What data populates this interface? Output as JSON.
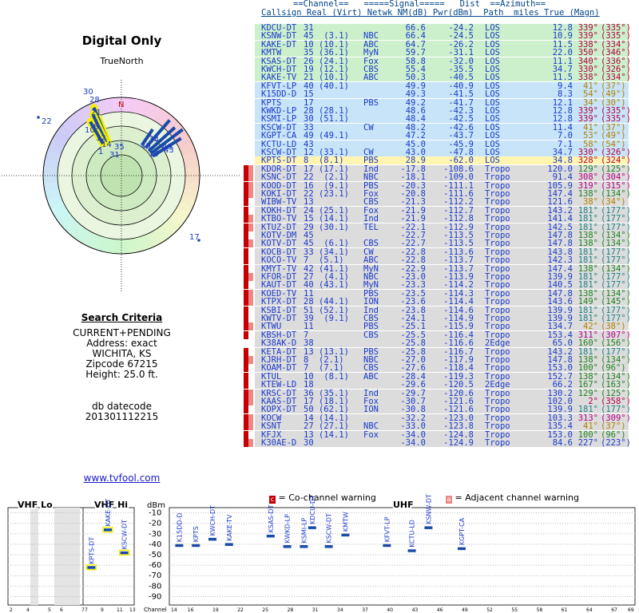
{
  "left": {
    "title": "Digital Only",
    "true_north_label": "TrueNorth",
    "north_marker": "N",
    "search_header": "Search Criteria",
    "search_lines": [
      "CURRENT+PENDING",
      "Address: exact",
      "WICHITA, KS",
      "Zipcode 67215",
      "Height: 25.0 ft."
    ],
    "db_header": "db datecode",
    "db_value": "201301112215",
    "site": "www.tvfool.com",
    "polar_labels": [
      {
        "t": "30",
        "c": "#1a3acc"
      },
      {
        "t": "28",
        "c": "#1a3acc"
      },
      {
        "t": "22",
        "c": "#1a3acc"
      },
      {
        "t": "21",
        "c": "#1a3acc"
      },
      {
        "t": "10",
        "c": "#1a3acc"
      },
      {
        "t": "12",
        "c": "#1a3acc"
      },
      {
        "t": "35",
        "c": "#1a3acc"
      },
      {
        "t": "31",
        "c": "#1a3acc"
      },
      {
        "t": "14",
        "c": "#1a3acc"
      },
      {
        "t": "33",
        "c": "#1a3acc"
      },
      {
        "t": "40",
        "c": "#1a3acc"
      },
      {
        "t": "49",
        "c": "#1a3acc"
      },
      {
        "t": "15",
        "c": "#1a3acc"
      },
      {
        "t": "43",
        "c": "#1a3acc"
      },
      {
        "t": "17",
        "c": "#1a3acc"
      },
      {
        "t": "8",
        "c": "#1a3acc"
      },
      {
        "t": "1",
        "c": "#1a3acc"
      }
    ]
  },
  "table": {
    "header_line1": "==Channel==   =====Signal=====   Dist  ==Azimuth==",
    "header_line2": "Callsign Real (Virt) Netwk NM(dB) Pwr(dBm)  Path  miles True (Magn)",
    "rows": [
      {
        "cs": "KDCU-DT",
        "rv": "31",
        "nw": "",
        "nm": "66.6",
        "pw": "-24.2",
        "pt": "LOS",
        "di": "12.8",
        "az": "339°",
        "mg": "(335°)",
        "bg": "green",
        "w": "",
        "ac": "#b00040"
      },
      {
        "cs": "KSNW-DT",
        "rv": "45  (3.1)",
        "nw": "NBC",
        "nm": "66.4",
        "pw": "-24.5",
        "pt": "LOS",
        "di": "10.9",
        "az": "339°",
        "mg": "(335°)",
        "bg": "green",
        "w": "",
        "ac": "#b00040"
      },
      {
        "cs": "KAKE-DT",
        "rv": "10 (10.1)",
        "nw": "ABC",
        "nm": "64.7",
        "pw": "-26.2",
        "pt": "LOS",
        "di": "11.5",
        "az": "338°",
        "mg": "(334°)",
        "bg": "green",
        "w": "",
        "ac": "#b00040"
      },
      {
        "cs": "KMTW",
        "rv": "35 (36.1)",
        "nw": "MyN",
        "nm": "59.7",
        "pw": "-31.1",
        "pt": "LOS",
        "di": "22.0",
        "az": "350°",
        "mg": "(346°)",
        "bg": "green",
        "w": "",
        "ac": "#b00040"
      },
      {
        "cs": "KSAS-DT",
        "rv": "26 (24.1)",
        "nw": "Fox",
        "nm": "58.8",
        "pw": "-32.0",
        "pt": "LOS",
        "di": "11.1",
        "az": "340°",
        "mg": "(336°)",
        "bg": "green",
        "w": "",
        "ac": "#b00040"
      },
      {
        "cs": "KWCH-DT",
        "rv": "19 (12.1)",
        "nw": "CBS",
        "nm": "55.4",
        "pw": "-35.5",
        "pt": "LOS",
        "di": "34.7",
        "az": "330°",
        "mg": "(326°)",
        "bg": "green",
        "w": "",
        "ac": "#b00040"
      },
      {
        "cs": "KAKE-TV",
        "rv": "21 (10.1)",
        "nw": "ABC",
        "nm": "50.3",
        "pw": "-40.5",
        "pt": "LOS",
        "di": "11.5",
        "az": "338°",
        "mg": "(334°)",
        "bg": "green",
        "w": "",
        "ac": "#b00040"
      },
      {
        "cs": "KFVT-LP",
        "rv": "40 (40.1)",
        "nw": "",
        "nm": "49.9",
        "pw": "-40.9",
        "pt": "LOS",
        "di": "9.4",
        "az": "41°",
        "mg": "(37°)",
        "bg": "blue",
        "w": "",
        "ac": "#b08000"
      },
      {
        "cs": "K15DD-D",
        "rv": "15",
        "nw": "",
        "nm": "49.3",
        "pw": "-41.5",
        "pt": "LOS",
        "di": "8.3",
        "az": "54°",
        "mg": "(49°)",
        "bg": "blue",
        "w": "",
        "ac": "#b08000"
      },
      {
        "cs": "KPTS",
        "rv": "17",
        "nw": "PBS",
        "nm": "49.2",
        "pw": "-41.7",
        "pt": "LOS",
        "di": "12.1",
        "az": "34°",
        "mg": "(30°)",
        "bg": "blue",
        "w": "",
        "ac": "#b08000"
      },
      {
        "cs": "KWKD-LP",
        "rv": "28 (28.1)",
        "nw": "",
        "nm": "48.6",
        "pw": "-42.3",
        "pt": "LOS",
        "di": "12.8",
        "az": "339°",
        "mg": "(335°)",
        "bg": "blue",
        "w": "",
        "ac": "#b00040"
      },
      {
        "cs": "KSMI-LP",
        "rv": "30 (51.1)",
        "nw": "",
        "nm": "48.4",
        "pw": "-42.5",
        "pt": "LOS",
        "di": "12.8",
        "az": "339°",
        "mg": "(335°)",
        "bg": "blue",
        "w": "",
        "ac": "#b00040"
      },
      {
        "cs": "KSCW-DT",
        "rv": "33",
        "nw": "CW",
        "nm": "48.2",
        "pw": "-42.6",
        "pt": "LOS",
        "di": "11.4",
        "az": "41°",
        "mg": "(37°)",
        "bg": "blue",
        "w": "",
        "ac": "#b08000"
      },
      {
        "cs": "KGPT-CA",
        "rv": "49 (49.1)",
        "nw": "",
        "nm": "47.2",
        "pw": "-43.7",
        "pt": "LOS",
        "di": "7.0",
        "az": "53°",
        "mg": "(49°)",
        "bg": "blue",
        "w": "",
        "ac": "#b08000"
      },
      {
        "cs": "KCTU-LD",
        "rv": "43",
        "nw": "",
        "nm": "45.0",
        "pw": "-45.9",
        "pt": "LOS",
        "di": "7.1",
        "az": "58°",
        "mg": "(54°)",
        "bg": "blue",
        "w": "",
        "ac": "#b08000"
      },
      {
        "cs": "KSCW-DT",
        "rv": "12 (33.1)",
        "nw": "CW",
        "nm": "43.0",
        "pw": "-47.8",
        "pt": "LOS",
        "di": "34.7",
        "az": "330°",
        "mg": "(326°)",
        "bg": "blue",
        "w": "",
        "ac": "#b00040"
      },
      {
        "cs": "KPTS-DT",
        "rv": "8  (8.1)",
        "nw": "PBS",
        "nm": "28.9",
        "pw": "-62.0",
        "pt": "LOS",
        "di": "34.8",
        "az": "328°",
        "mg": "(324°)",
        "bg": "yellow",
        "w": "",
        "ac": "#b00040"
      },
      {
        "cs": "KDOR-DT",
        "rv": "17 (17.1)",
        "nw": "Ind",
        "nm": "-17.8",
        "pw": "-108.6",
        "pt": "Tropo",
        "di": "120.0",
        "az": "129°",
        "mg": "(125°)",
        "bg": "gray",
        "w": "ac",
        "ac": "#208020"
      },
      {
        "cs": "KSNC-DT",
        "rv": "22  (2.1)",
        "nw": "NBC",
        "nm": "-18.1",
        "pw": "-109.0",
        "pt": "Tropo",
        "di": "91.4",
        "az": "308°",
        "mg": "(304°)",
        "bg": "gray",
        "w": "ac",
        "ac": "#b00080"
      },
      {
        "cs": "KOOD-DT",
        "rv": "16  (9.1)",
        "nw": "PBS",
        "nm": "-20.3",
        "pw": "-111.1",
        "pt": "Tropo",
        "di": "105.9",
        "az": "319°",
        "mg": "(315°)",
        "bg": "gray",
        "w": "ac",
        "ac": "#b00080"
      },
      {
        "cs": "KOKI-DT",
        "rv": "22 (23.1)",
        "nw": "Fox",
        "nm": "-20.8",
        "pw": "-111.6",
        "pt": "Tropo",
        "di": "147.4",
        "az": "138°",
        "mg": "(134°)",
        "bg": "gray",
        "w": "ac",
        "ac": "#208020"
      },
      {
        "cs": "WIBW-TV",
        "rv": "13",
        "nw": "CBS",
        "nm": "-21.3",
        "pw": "-112.2",
        "pt": "Tropo",
        "di": "121.6",
        "az": "38°",
        "mg": "(34°)",
        "bg": "gray",
        "w": "c",
        "ac": "#b08000"
      },
      {
        "cs": "KOKH-DT",
        "rv": "24 (25.1)",
        "nw": "Fox",
        "nm": "-21.9",
        "pw": "-112.7",
        "pt": "Tropo",
        "di": "143.2",
        "az": "181°",
        "mg": "(177°)",
        "bg": "gray",
        "w": "c",
        "ac": "#208080"
      },
      {
        "cs": "KTBO-TV",
        "rv": "15 (14.1)",
        "nw": "Ind",
        "nm": "-21.9",
        "pw": "-112.8",
        "pt": "Tropo",
        "di": "141.4",
        "az": "181°",
        "mg": "(177°)",
        "bg": "gray",
        "w": "ac",
        "ac": "#208080"
      },
      {
        "cs": "KTUZ-DT",
        "rv": "29 (30.1)",
        "nw": "TEL",
        "nm": "-22.1",
        "pw": "-112.9",
        "pt": "Tropo",
        "di": "142.5",
        "az": "181°",
        "mg": "(177°)",
        "bg": "gray",
        "w": "ac",
        "ac": "#208080"
      },
      {
        "cs": "KOTV-DM",
        "rv": "45",
        "nw": "",
        "nm": "-22.7",
        "pw": "-113.5",
        "pt": "Tropo",
        "di": "147.8",
        "az": "138°",
        "mg": "(134°)",
        "bg": "gray",
        "w": "c",
        "ac": "#208020"
      },
      {
        "cs": "KOTV-DT",
        "rv": "45  (6.1)",
        "nw": "CBS",
        "nm": "-22.7",
        "pw": "-113.5",
        "pt": "Tropo",
        "di": "147.8",
        "az": "138°",
        "mg": "(134°)",
        "bg": "gray",
        "w": "ac",
        "ac": "#208020"
      },
      {
        "cs": "KOCB-DT",
        "rv": "33 (34.1)",
        "nw": "CW",
        "nm": "-22.8",
        "pw": "-113.6",
        "pt": "Tropo",
        "di": "143.8",
        "az": "181°",
        "mg": "(177°)",
        "bg": "gray",
        "w": "c",
        "ac": "#208080"
      },
      {
        "cs": "KOCO-TV",
        "rv": "7  (5.1)",
        "nw": "ABC",
        "nm": "-22.8",
        "pw": "-113.7",
        "pt": "Tropo",
        "di": "142.3",
        "az": "181°",
        "mg": "(177°)",
        "bg": "gray",
        "w": "c",
        "ac": "#208080"
      },
      {
        "cs": "KMYT-TV",
        "rv": "42 (41.1)",
        "nw": "MyN",
        "nm": "-22.9",
        "pw": "-113.7",
        "pt": "Tropo",
        "di": "147.4",
        "az": "138°",
        "mg": "(134°)",
        "bg": "gray",
        "w": "c",
        "ac": "#208020"
      },
      {
        "cs": "KFOR-DT",
        "rv": "27  (4.1)",
        "nw": "NBC",
        "nm": "-23.0",
        "pw": "-113.9",
        "pt": "Tropo",
        "di": "139.9",
        "az": "181°",
        "mg": "(177°)",
        "bg": "gray",
        "w": "ac",
        "ac": "#208080"
      },
      {
        "cs": "KAUT-DT",
        "rv": "40 (43.1)",
        "nw": "MyN",
        "nm": "-23.3",
        "pw": "-114.2",
        "pt": "Tropo",
        "di": "140.5",
        "az": "181°",
        "mg": "(177°)",
        "bg": "gray",
        "w": "c",
        "ac": "#208080"
      },
      {
        "cs": "KOED-TV",
        "rv": "11",
        "nw": "PBS",
        "nm": "-23.5",
        "pw": "-114.3",
        "pt": "Tropo",
        "di": "147.8",
        "az": "138°",
        "mg": "(134°)",
        "bg": "gray",
        "w": "ac",
        "ac": "#208020"
      },
      {
        "cs": "KTPX-DT",
        "rv": "28 (44.1)",
        "nw": "ION",
        "nm": "-23.6",
        "pw": "-114.4",
        "pt": "Tropo",
        "di": "143.6",
        "az": "149°",
        "mg": "(145°)",
        "bg": "gray",
        "w": "ac",
        "ac": "#208020"
      },
      {
        "cs": "KSBI-DT",
        "rv": "51 (52.1)",
        "nw": "Ind",
        "nm": "-23.8",
        "pw": "-114.6",
        "pt": "Tropo",
        "di": "139.9",
        "az": "181°",
        "mg": "(177°)",
        "bg": "gray",
        "w": "c",
        "ac": "#208080"
      },
      {
        "cs": "KWTV-DT",
        "rv": "39  (9.1)",
        "nw": "CBS",
        "nm": "-24.1",
        "pw": "-114.9",
        "pt": "Tropo",
        "di": "139.9",
        "az": "181°",
        "mg": "(177°)",
        "bg": "gray",
        "w": "c",
        "ac": "#208080"
      },
      {
        "cs": "KTWU",
        "rv": "11",
        "nw": "PBS",
        "nm": "-25.1",
        "pw": "-115.9",
        "pt": "Tropo",
        "di": "134.7",
        "az": "42°",
        "mg": "(38°)",
        "bg": "gray",
        "w": "ac",
        "ac": "#b08000"
      },
      {
        "cs": "KBSH-DT",
        "rv": "7",
        "nw": "CBS",
        "nm": "-25.5",
        "pw": "-116.4",
        "pt": "Tropo",
        "di": "153.4",
        "az": "311°",
        "mg": "(307°)",
        "bg": "gray",
        "w": "c",
        "ac": "#b00080"
      },
      {
        "cs": "K38AK-D",
        "rv": "38",
        "nw": "",
        "nm": "-25.8",
        "pw": "-116.6",
        "pt": "2Edge",
        "di": "65.0",
        "az": "160°",
        "mg": "(156°)",
        "bg": "gray",
        "w": "",
        "ac": "#208020"
      },
      {
        "cs": "KETA-DT",
        "rv": "13 (13.1)",
        "nw": "PBS",
        "nm": "-25.8",
        "pw": "-116.7",
        "pt": "Tropo",
        "di": "143.2",
        "az": "181°",
        "mg": "(177°)",
        "bg": "gray",
        "w": "c",
        "ac": "#208080"
      },
      {
        "cs": "KJRH-DT",
        "rv": "8  (2.1)",
        "nw": "NBC",
        "nm": "-27.0",
        "pw": "-117.9",
        "pt": "Tropo",
        "di": "147.8",
        "az": "138°",
        "mg": "(134°)",
        "bg": "gray",
        "w": "ac",
        "ac": "#208020"
      },
      {
        "cs": "KOAM-DT",
        "rv": "7  (7.1)",
        "nw": "CBS",
        "nm": "-27.6",
        "pw": "-118.4",
        "pt": "Tropo",
        "di": "153.0",
        "az": "100°",
        "mg": "(96°)",
        "bg": "gray",
        "w": "c",
        "ac": "#208020"
      },
      {
        "cs": "KTUL",
        "rv": "10  (8.1)",
        "nw": "ABC",
        "nm": "-28.4",
        "pw": "-119.3",
        "pt": "Tropo",
        "di": "152.7",
        "az": "138°",
        "mg": "(134°)",
        "bg": "gray",
        "w": "c",
        "ac": "#208020"
      },
      {
        "cs": "KTEW-LD",
        "rv": "18",
        "nw": "",
        "nm": "-29.6",
        "pw": "-120.5",
        "pt": "2Edge",
        "di": "66.2",
        "az": "167°",
        "mg": "(163°)",
        "bg": "gray",
        "w": "c",
        "ac": "#208020"
      },
      {
        "cs": "KRSC-DT",
        "rv": "36 (35.1)",
        "nw": "Ind",
        "nm": "-29.7",
        "pw": "-120.6",
        "pt": "Tropo",
        "di": "130.2",
        "az": "129°",
        "mg": "(125°)",
        "bg": "gray",
        "w": "ac",
        "ac": "#208020"
      },
      {
        "cs": "KAAS-DT",
        "rv": "17 (18.1)",
        "nw": "Fox",
        "nm": "-30.7",
        "pw": "-121.6",
        "pt": "Tropo",
        "di": "102.0",
        "az": "2°",
        "mg": "(358°)",
        "bg": "gray",
        "w": "ac",
        "ac": "#b00040"
      },
      {
        "cs": "KOPX-DT",
        "rv": "50 (62.1)",
        "nw": "ION",
        "nm": "-30.8",
        "pw": "-121.6",
        "pt": "Tropo",
        "di": "139.9",
        "az": "181°",
        "mg": "(177°)",
        "bg": "gray",
        "w": "c",
        "ac": "#208080"
      },
      {
        "cs": "KOCW",
        "rv": "14 (14.1)",
        "nw": "",
        "nm": "-32.2",
        "pw": "-123.0",
        "pt": "Tropo",
        "di": "103.3",
        "az": "313°",
        "mg": "(309°)",
        "bg": "gray",
        "w": "ac",
        "ac": "#b00080"
      },
      {
        "cs": "KSNT",
        "rv": "27 (27.1)",
        "nw": "NBC",
        "nm": "-33.0",
        "pw": "-123.8",
        "pt": "Tropo",
        "di": "135.4",
        "az": "41°",
        "mg": "(37°)",
        "bg": "gray",
        "w": "ac",
        "ac": "#b08000"
      },
      {
        "cs": "KFJX",
        "rv": "13 (14.1)",
        "nw": "Fox",
        "nm": "-34.0",
        "pw": "-124.8",
        "pt": "Tropo",
        "di": "153.0",
        "az": "100°",
        "mg": "(96°)",
        "bg": "gray",
        "w": "c",
        "ac": "#208020"
      },
      {
        "cs": "K30AE-D",
        "rv": "30",
        "nw": "",
        "nm": "-34.0",
        "pw": "-124.9",
        "pt": "Tropo",
        "di": "84.6",
        "az": "227°",
        "mg": "(223°)",
        "bg": "gray",
        "w": "ac",
        "ac": "#1a3acc"
      }
    ]
  },
  "bottom": {
    "co_channel_warning": "= Co-channel warning",
    "adjacent_warning": "= Adjacent channel warning",
    "warn_c_glyph": "c",
    "warn_a_glyph": "a",
    "vhf_lo": "VHF Lo",
    "vhf_hi": "VHF Hi",
    "uhf": "UHF",
    "dbm_label": "dBm",
    "channel_label": "Channel",
    "dbm_ticks": [
      "-10",
      "-20",
      "-30",
      "-40",
      "-50",
      "-60",
      "-70",
      "-80",
      "-90"
    ],
    "vhf_lo_ticks": [
      "2",
      "4",
      "5",
      "6",
      "7"
    ],
    "vhf_hi_ticks": [
      "7",
      "9",
      "11",
      "13"
    ],
    "uhf_ticks": [
      "14",
      "16",
      "19",
      "22",
      "25",
      "28",
      "31",
      "34",
      "37",
      "40",
      "43",
      "46",
      "49",
      "52",
      "55",
      "58",
      "61",
      "64",
      "67",
      "69"
    ],
    "bar_stations": [
      {
        "name": "KPTS-DT",
        "ch": 8,
        "dbm": -62
      },
      {
        "name": "KAKE-DT",
        "ch": 10,
        "dbm": -26
      },
      {
        "name": "KSCW-DT",
        "ch": 12,
        "dbm": -48
      },
      {
        "name": "K15DD-D",
        "ch": 15,
        "dbm": -41
      },
      {
        "name": "KPTS",
        "ch": 17,
        "dbm": -41
      },
      {
        "name": "KWCH-DT",
        "ch": 19,
        "dbm": -35
      },
      {
        "name": "KAKE-TV",
        "ch": 21,
        "dbm": -40
      },
      {
        "name": "KSAS-DT",
        "ch": 26,
        "dbm": -32
      },
      {
        "name": "KWKD-LP",
        "ch": 28,
        "dbm": -42
      },
      {
        "name": "KSMI-LP",
        "ch": 30,
        "dbm": -42
      },
      {
        "name": "KDCU-DT",
        "ch": 31,
        "dbm": -24
      },
      {
        "name": "KSCW-DT",
        "ch": 33,
        "dbm": -42
      },
      {
        "name": "KMTW",
        "ch": 35,
        "dbm": -31
      },
      {
        "name": "KFVT-LP",
        "ch": 40,
        "dbm": -41
      },
      {
        "name": "KCTU-LD",
        "ch": 43,
        "dbm": -46
      },
      {
        "name": "KSNW-DT",
        "ch": 45,
        "dbm": -24
      },
      {
        "name": "KGPT-CA",
        "ch": 49,
        "dbm": -44
      }
    ]
  }
}
